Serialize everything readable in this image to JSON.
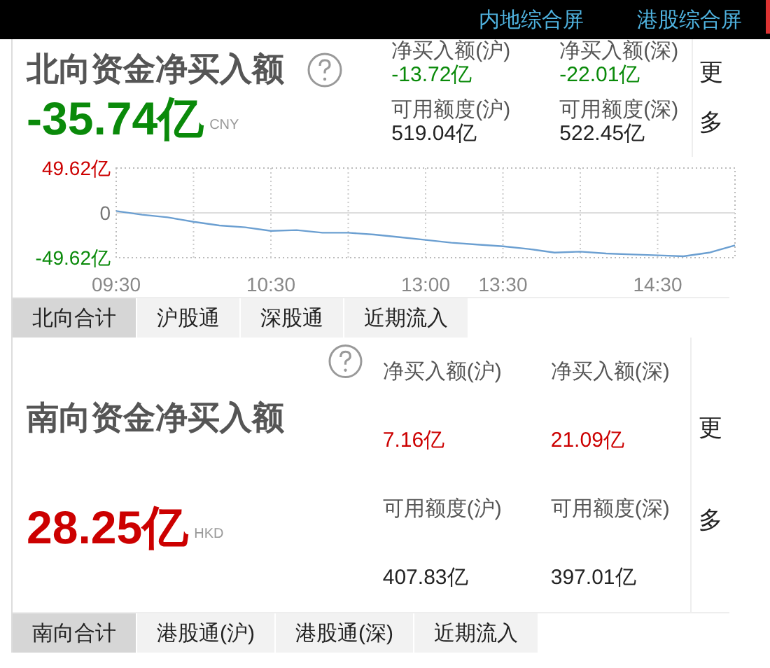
{
  "top_bar": {
    "links": [
      "内地综合屏",
      "港股综合屏"
    ]
  },
  "northbound": {
    "title": "北向资金净买入额",
    "total": "-35.74亿",
    "color": "#0a8a0a",
    "currency": "CNY",
    "stats": [
      {
        "label": "净买入额(沪)",
        "value": "-13.72亿",
        "color": "#0a8a0a"
      },
      {
        "label": "净买入额(深)",
        "value": "-22.01亿",
        "color": "#0a8a0a"
      },
      {
        "label": "可用额度(沪)",
        "value": "519.04亿",
        "color": "#222222"
      },
      {
        "label": "可用额度(深)",
        "value": "522.45亿",
        "color": "#222222"
      }
    ],
    "more": "更多",
    "chart_data": {
      "type": "line",
      "grid": true,
      "categories": [
        "09:30",
        null,
        null,
        null,
        null,
        null,
        "10:30",
        null,
        null,
        null,
        null,
        null,
        "13:00",
        null,
        null,
        "13:30",
        null,
        null,
        null,
        null,
        null,
        "14:30",
        null,
        null,
        null
      ],
      "series": [
        {
          "color": "#6b9fd1",
          "values": [
            2,
            -2,
            -5,
            -10,
            -14,
            -16,
            -20,
            -19,
            -22,
            -22,
            -24,
            -27,
            -30,
            -33,
            -35,
            -37,
            -40,
            -44,
            -43,
            -45,
            -46,
            -47,
            -48,
            -44,
            -36
          ]
        }
      ],
      "ylim": [
        -49.62,
        49.62
      ],
      "yticks": [
        {
          "value": 49.62,
          "label": "49.62亿"
        },
        {
          "value": 0,
          "label": "0"
        },
        {
          "value": -49.62,
          "label": "-49.62亿"
        }
      ]
    },
    "tabs": [
      {
        "label": "北向合计",
        "selected": true
      },
      {
        "label": "沪股通",
        "selected": false
      },
      {
        "label": "深股通",
        "selected": false
      },
      {
        "label": "近期流入",
        "selected": false
      }
    ]
  },
  "southbound": {
    "title": "南向资金净买入额",
    "total": "28.25亿",
    "color": "#cc0000",
    "currency": "HKD",
    "stats": [
      {
        "label": "净买入额(沪)",
        "value": "7.16亿",
        "color": "#cc0000"
      },
      {
        "label": "净买入额(深)",
        "value": "21.09亿",
        "color": "#cc0000"
      },
      {
        "label": "可用额度(沪)",
        "value": "407.83亿",
        "color": "#222222"
      },
      {
        "label": "可用额度(深)",
        "value": "397.01亿",
        "color": "#222222"
      }
    ],
    "more": "更多",
    "tabs": [
      {
        "label": "南向合计",
        "selected": true
      },
      {
        "label": "港股通(沪)",
        "selected": false
      },
      {
        "label": "港股通(深)",
        "selected": false
      },
      {
        "label": "近期流入",
        "selected": false
      }
    ]
  }
}
